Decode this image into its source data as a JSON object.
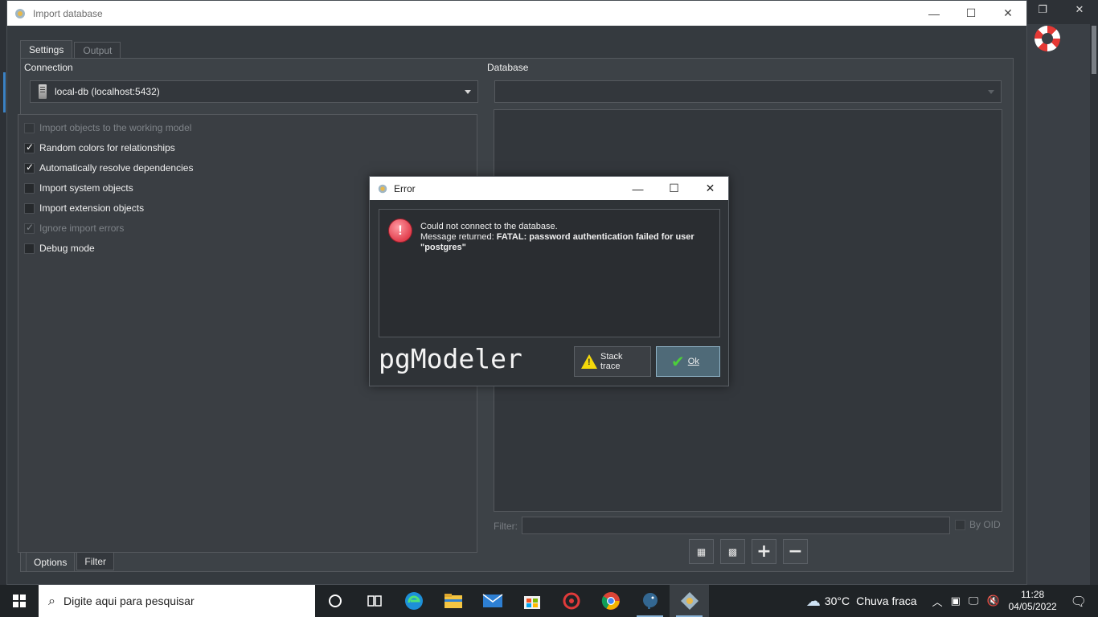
{
  "window": {
    "title": "Import database",
    "tabs_top": [
      "Settings",
      "Output"
    ],
    "connection_label": "Connection",
    "connection_value": "local-db (localhost:5432)",
    "database_label": "Database",
    "options": [
      {
        "label": "Import objects to the working model",
        "checked": false,
        "disabled": true
      },
      {
        "label": "Random colors for relationships",
        "checked": true,
        "disabled": false
      },
      {
        "label": "Automatically resolve dependencies",
        "checked": true,
        "disabled": false
      },
      {
        "label": "Import system objects",
        "checked": false,
        "disabled": false
      },
      {
        "label": "Import extension objects",
        "checked": false,
        "disabled": false
      },
      {
        "label": "Ignore import errors",
        "checked": true,
        "disabled": true
      },
      {
        "label": "Debug mode",
        "checked": false,
        "disabled": false
      }
    ],
    "tabs_bottom": [
      "Options",
      "Filter"
    ],
    "filter_label": "Filter:",
    "by_oid_label": "By OID"
  },
  "dialog": {
    "title": "Error",
    "line1": "Could not connect to the database.",
    "line2_prefix": "Message returned: ",
    "line2_bold": "FATAL: password authentication failed for user \"postgres\"",
    "logo_text": "pgModeler",
    "stack_trace_label": "Stack trace",
    "ok_label": "Ok"
  },
  "taskbar": {
    "search_placeholder": "Digite aqui para pesquisar",
    "weather_temp": "30°C",
    "weather_desc": "Chuva fraca",
    "time": "11:28",
    "date": "04/05/2022"
  },
  "colors": {
    "panel_bg": "#3d4247",
    "dialog_primary": "#4f6a78",
    "error_red": "#e2404f",
    "warning_yellow": "#f5d90a"
  }
}
